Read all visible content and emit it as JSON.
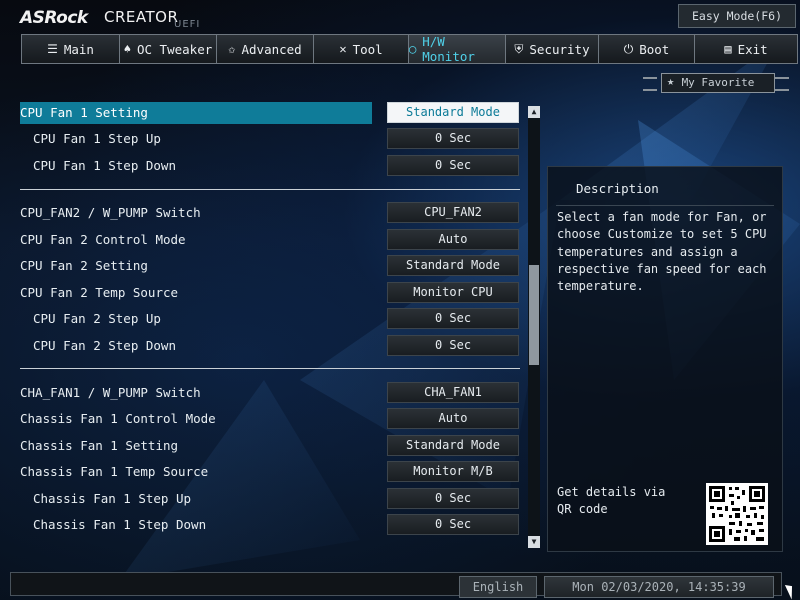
{
  "header": {
    "brand": "ASRock",
    "model": "CREATOR",
    "uefi": "UEFI",
    "easy_mode": "Easy Mode(F6)"
  },
  "tabs": [
    {
      "label": "Main",
      "icon": "list-icon"
    },
    {
      "label": "OC Tweaker",
      "icon": "rocket-icon"
    },
    {
      "label": "Advanced",
      "icon": "star-icon"
    },
    {
      "label": "Tool",
      "icon": "tools-icon"
    },
    {
      "label": "H/W Monitor",
      "icon": "monitor-icon",
      "active": true
    },
    {
      "label": "Security",
      "icon": "shield-icon"
    },
    {
      "label": "Boot",
      "icon": "power-icon"
    },
    {
      "label": "Exit",
      "icon": "exit-icon"
    }
  ],
  "favorite": {
    "label": "My Favorite",
    "icon": "star-icon"
  },
  "settings": [
    {
      "label": "CPU Fan 1 Setting",
      "value": "Standard Mode",
      "selected": true
    },
    {
      "label": "CPU Fan 1 Step Up",
      "value": "0 Sec"
    },
    {
      "label": "CPU Fan 1 Step Down",
      "value": "0 Sec"
    },
    {
      "label": "CPU_FAN2 / W_PUMP Switch",
      "value": "CPU_FAN2"
    },
    {
      "label": "CPU Fan 2 Control Mode",
      "value": "Auto"
    },
    {
      "label": "CPU Fan 2 Setting",
      "value": "Standard Mode"
    },
    {
      "label": "CPU Fan 2 Temp Source",
      "value": "Monitor CPU"
    },
    {
      "label": "CPU Fan 2 Step Up",
      "value": "0 Sec"
    },
    {
      "label": "CPU Fan 2 Step Down",
      "value": "0 Sec"
    },
    {
      "label": "CHA_FAN1 / W_PUMP Switch",
      "value": "CHA_FAN1"
    },
    {
      "label": "Chassis Fan 1 Control Mode",
      "value": "Auto"
    },
    {
      "label": "Chassis Fan 1 Setting",
      "value": "Standard Mode"
    },
    {
      "label": "Chassis Fan 1 Temp Source",
      "value": "Monitor M/B"
    },
    {
      "label": "Chassis Fan 1 Step Up",
      "value": "0 Sec"
    },
    {
      "label": "Chassis Fan 1 Step Down",
      "value": "0 Sec"
    }
  ],
  "description": {
    "title": "Description",
    "text": "Select a fan mode for Fan, or choose Customize to set 5 CPU temperatures and assign a respective fan speed for each temperature.",
    "qr_text": "Get details via QR code"
  },
  "footer": {
    "language": "English",
    "datetime": "Mon 02/03/2020, 14:35:39"
  },
  "colors": {
    "accent": "#0f7c99",
    "active_tab_text": "#4fd0e8"
  }
}
